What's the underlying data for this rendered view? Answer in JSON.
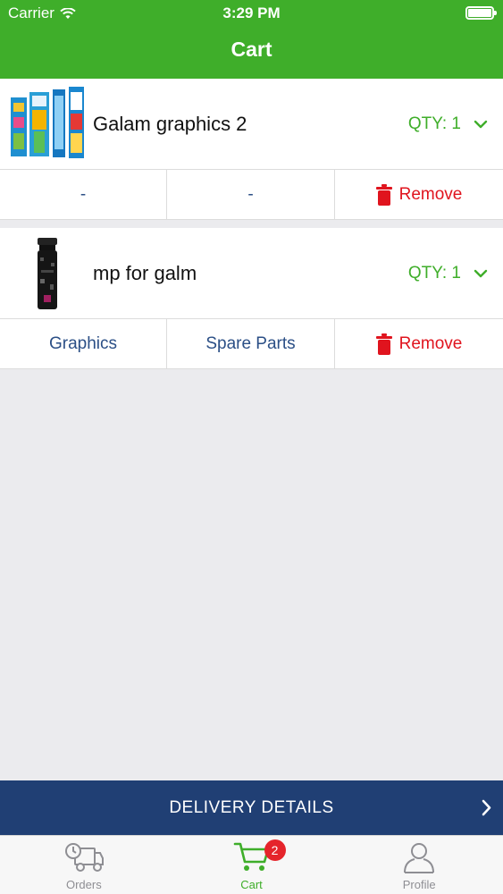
{
  "status_bar": {
    "carrier": "Carrier",
    "time": "3:29 PM"
  },
  "header": {
    "title": "Cart"
  },
  "cart_items": [
    {
      "name": "Galam graphics 2",
      "qty_label": "QTY: 1",
      "actions": {
        "left": "-",
        "middle": "-",
        "remove": "Remove"
      }
    },
    {
      "name": "mp for galm",
      "qty_label": "QTY: 1",
      "actions": {
        "left": "Graphics",
        "middle": "Spare Parts",
        "remove": "Remove"
      }
    }
  ],
  "delivery_button": {
    "label": "DELIVERY DETAILS"
  },
  "tabbar": {
    "tabs": [
      {
        "label": "Orders",
        "icon": "truck-icon"
      },
      {
        "label": "Cart",
        "icon": "cart-icon",
        "badge": "2"
      },
      {
        "label": "Profile",
        "icon": "person-icon"
      }
    ]
  },
  "colors": {
    "brand_green": "#3fae2a",
    "navy": "#203f74",
    "remove_red": "#e0141e",
    "link_blue": "#2b4f86"
  }
}
